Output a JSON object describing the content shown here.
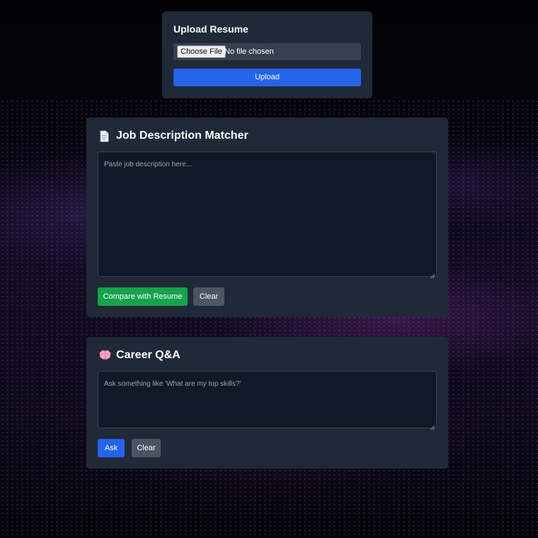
{
  "upload": {
    "title": "Upload Resume",
    "choose_file_label": "Choose File",
    "file_status": "No file chosen",
    "upload_button": "Upload"
  },
  "job_matcher": {
    "title": "Job Description Matcher",
    "icon": "document-icon",
    "textarea_placeholder": "Paste job description here...",
    "compare_button": "Compare with Resume",
    "clear_button": "Clear"
  },
  "career_qa": {
    "title": "Career Q&A",
    "icon": "brain-icon",
    "textarea_placeholder": "Ask something like 'What are my top skills?'",
    "ask_button": "Ask",
    "clear_button": "Clear"
  },
  "colors": {
    "card_background": "#1f2937",
    "input_background": "#111827",
    "primary": "#2563eb",
    "success": "#16a34a",
    "secondary": "#4b5563"
  }
}
